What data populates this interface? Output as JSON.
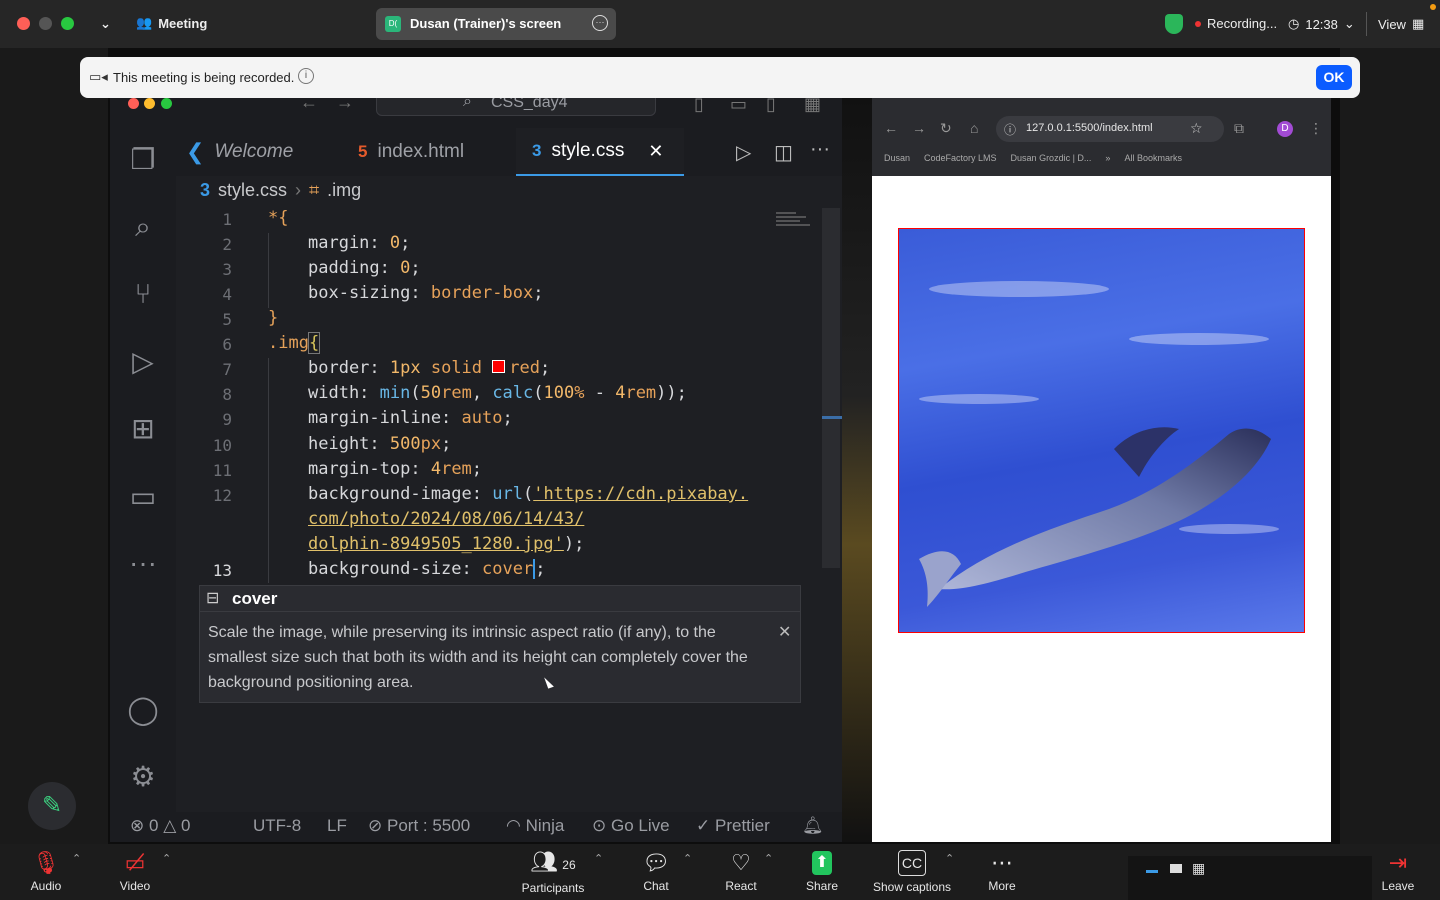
{
  "zoom": {
    "meeting_label": "Meeting",
    "screen_share_title": "Dusan (Trainer)'s screen",
    "screen_share_initials": "D(",
    "recording_label": "Recording...",
    "timer": "12:38",
    "view_label": "View",
    "banner_text": "This meeting is being recorded.",
    "banner_ok": "OK",
    "toolbar": {
      "audio": "Audio",
      "video": "Video",
      "participants": "Participants",
      "participants_count": "26",
      "chat": "Chat",
      "react": "React",
      "share": "Share",
      "captions": "Show captions",
      "more": "More",
      "leave": "Leave"
    }
  },
  "vscode": {
    "search_title": "CSS_day4",
    "tabs": [
      {
        "label": "Welcome"
      },
      {
        "label": "index.html"
      },
      {
        "label": "style.css"
      }
    ],
    "breadcrumb": {
      "file": "style.css",
      "symbol": ".img"
    },
    "line_numbers": [
      "1",
      "2",
      "3",
      "4",
      "5",
      "6",
      "7",
      "8",
      "9",
      "10",
      "11",
      "12",
      "13"
    ],
    "code": {
      "l1": "*{",
      "l2_prop": "margin: ",
      "l2_val": "0",
      "l2_end": ";",
      "l3_prop": "padding: ",
      "l3_val": "0",
      "l3_end": ";",
      "l4_prop": "box-sizing: ",
      "l4_val": "border-box",
      "l4_end": ";",
      "l5": "}",
      "l6_sel": ".img",
      "l6_brace": "{",
      "l7_prop": "border: ",
      "l7_n": "1px",
      "l7_solid": " solid ",
      "l7_red": "red",
      "l7_end": ";",
      "l8_prop": "width: ",
      "l8_f1": "min",
      "l8_a": "(",
      "l8_n1": "50",
      "l8_u1": "rem",
      "l8_b": ", ",
      "l8_f2": "calc",
      "l8_c": "(",
      "l8_n2": "100",
      "l8_u2": "%",
      "l8_d": " - ",
      "l8_n3": "4",
      "l8_u3": "rem",
      "l8_e": "));",
      "l9_prop": "margin-inline: ",
      "l9_val": "auto",
      "l9_end": ";",
      "l10_prop": "height: ",
      "l10_n": "500",
      "l10_u": "px",
      "l10_end": ";",
      "l11_prop": "margin-top: ",
      "l11_n": "4",
      "l11_u": "rem",
      "l11_end": ";",
      "l12_prop": "background-image: ",
      "l12_f": "url",
      "l12_a": "(",
      "l12_s1": "'https://cdn.pixabay.",
      "l12_s2": "com/photo/2024/08/06/14/43/",
      "l12_s3": "dolphin-8949505_1280.jpg'",
      "l12_end": ");",
      "l13_prop": "background-size: ",
      "l13_val": "cover",
      "l13_end": ";"
    },
    "suggestion": {
      "label": "cover",
      "description": "Scale the image, while preserving its intrinsic aspect ratio (if any), to the smallest size such that both its width and its height can completely cover the background positioning area."
    },
    "status": {
      "errors": "0",
      "warnings": "0",
      "encoding": "UTF-8",
      "eol": "LF",
      "port": "Port : 5500",
      "ninja": "Ninja",
      "golive": "Go Live",
      "prettier": "Prettier"
    }
  },
  "browser": {
    "url": "127.0.0.1:5500/index.html",
    "profile_initial": "D",
    "bookmarks": [
      "Dusan",
      "CodeFactory LMS",
      "Dusan Grozdic | D..."
    ],
    "all_bookmarks": "All Bookmarks"
  }
}
